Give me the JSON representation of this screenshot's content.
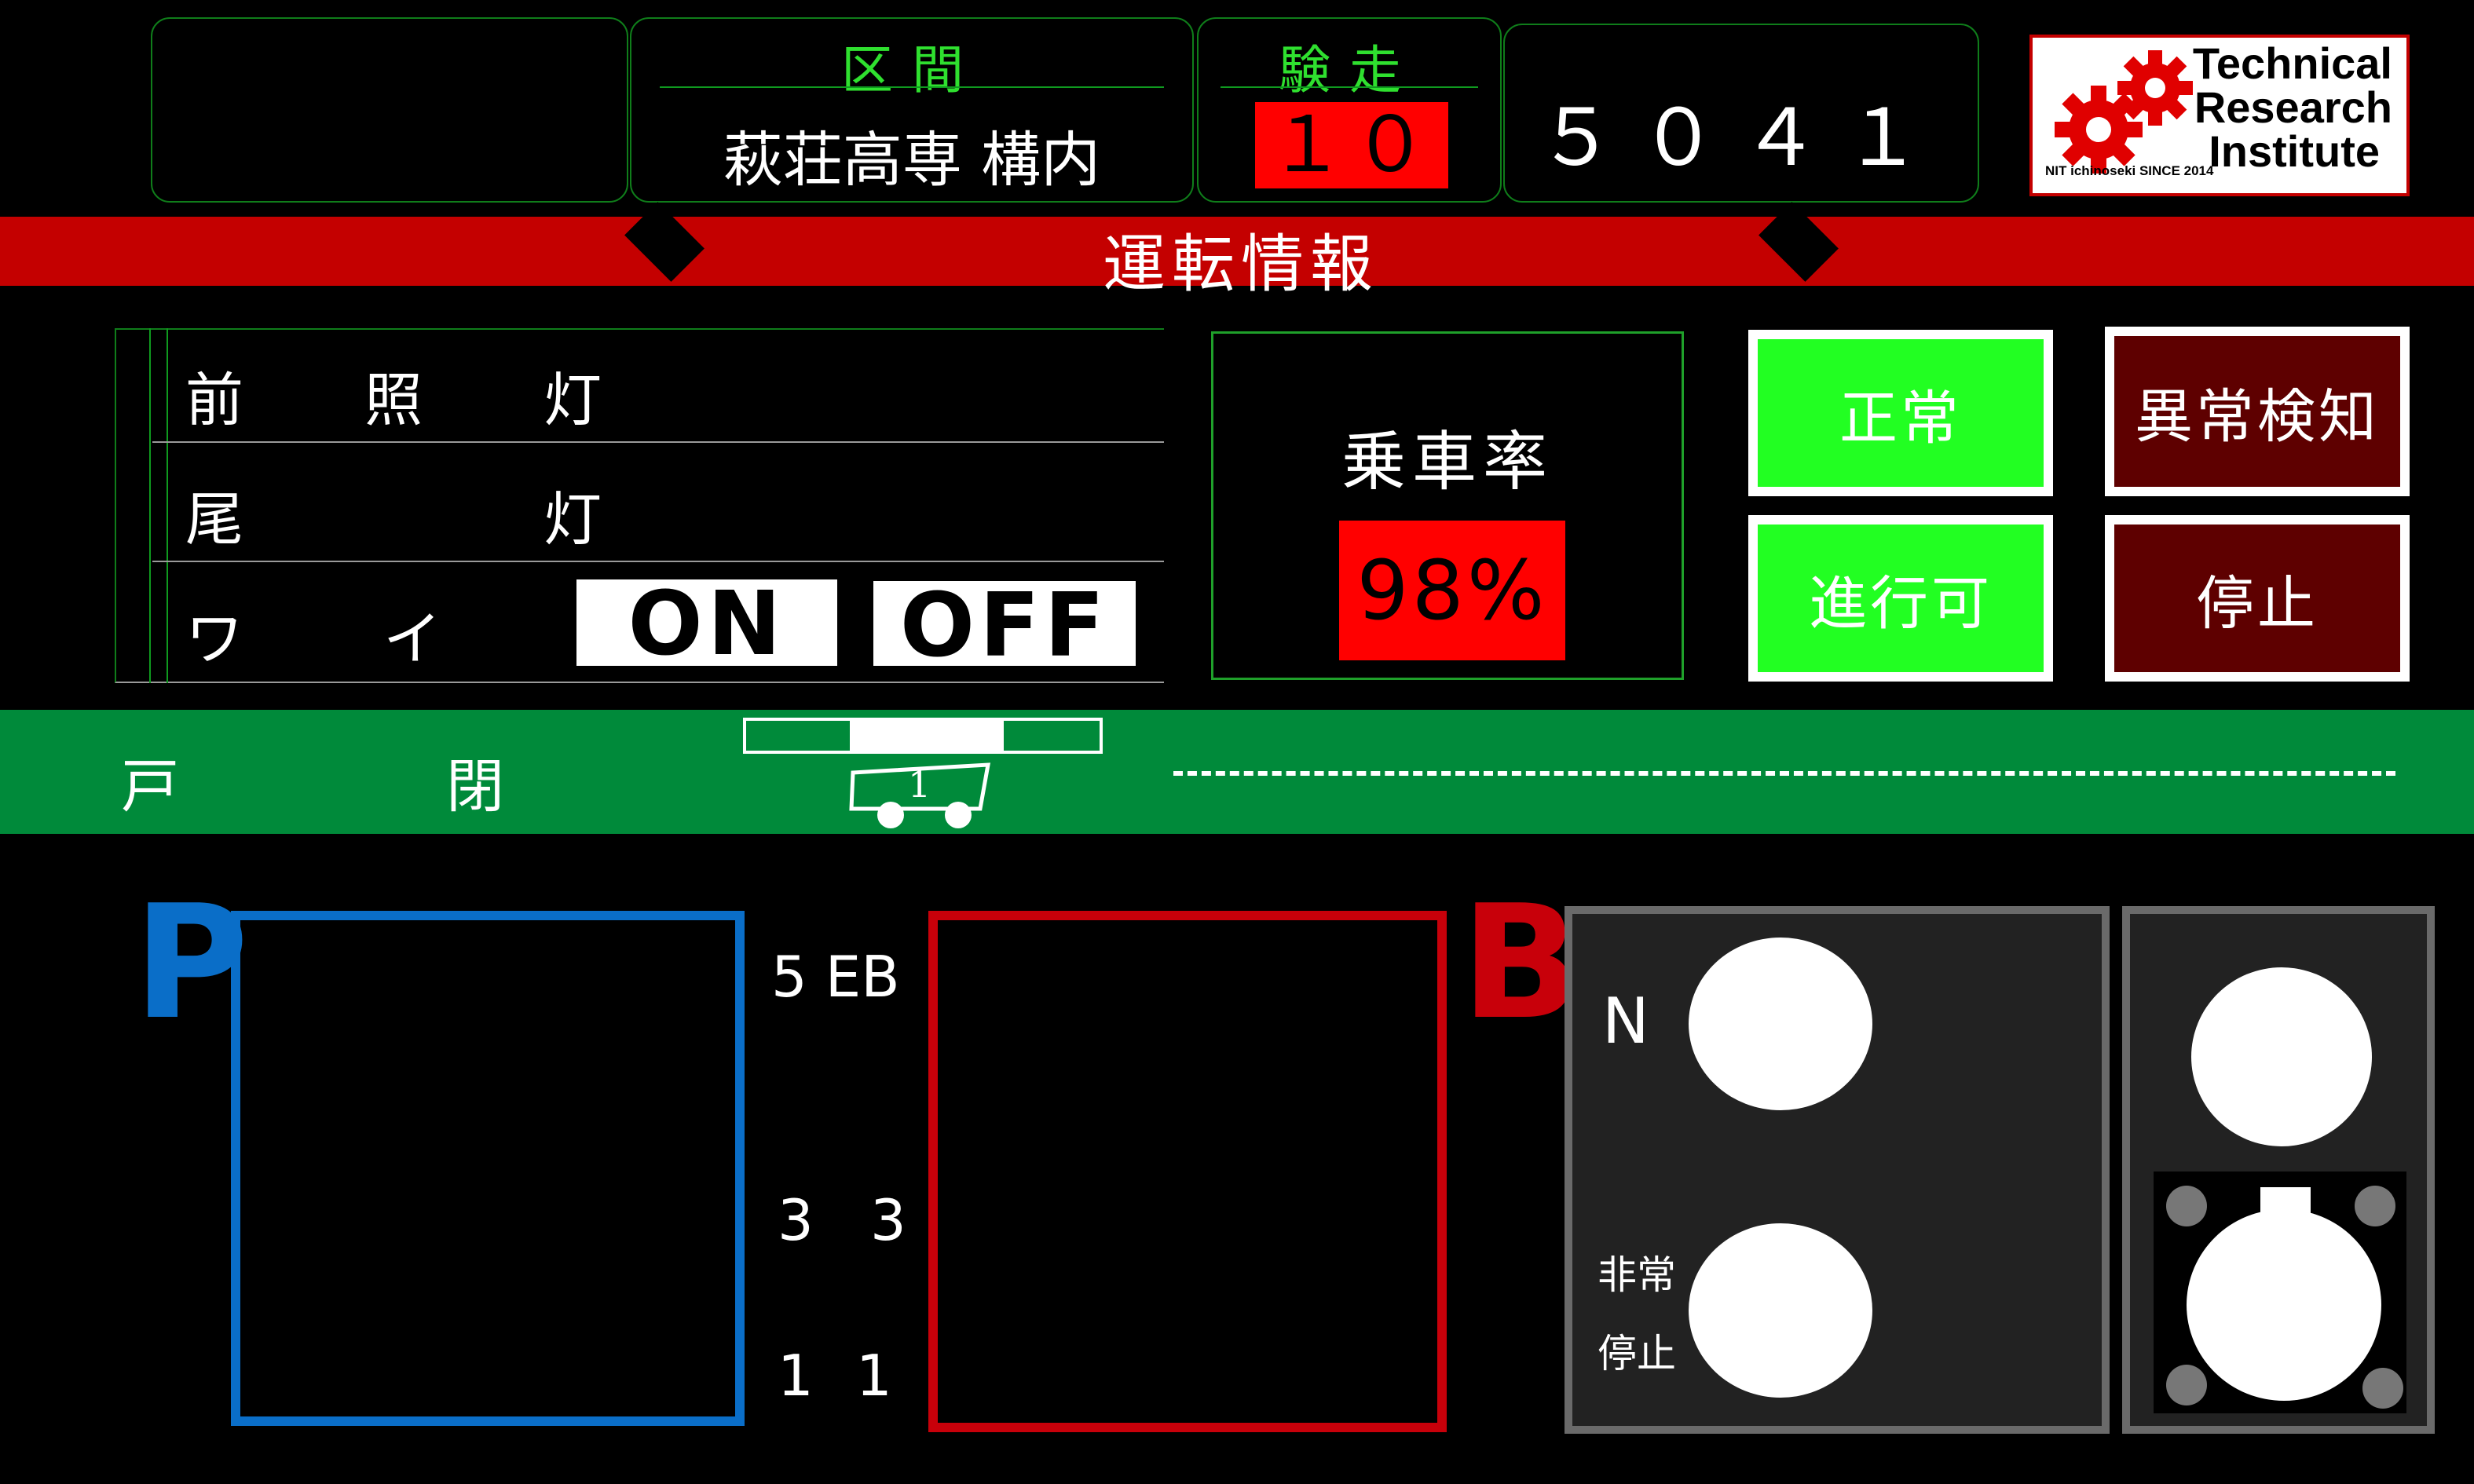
{
  "header": {
    "section_label": "区間",
    "section_value": "萩荘高専 構内",
    "run_label": "験走",
    "run_value": "１０",
    "train_number": "５０４１レ",
    "logo": {
      "text_line1": "Technical",
      "text_line2": "Research",
      "text_line3": "Institute",
      "subtext": "NIT ichinoseki SINCE 2014"
    }
  },
  "banner": {
    "title": "運転情報"
  },
  "info_table": {
    "rows": [
      {
        "label": "前　照　灯"
      },
      {
        "label": "尾　　　灯"
      },
      {
        "label": "ワ　イ　パ　ー"
      }
    ],
    "wiper_on": "ON",
    "wiper_off": "OFF"
  },
  "occupancy": {
    "label": "乗車率",
    "value": "98%"
  },
  "status": {
    "normal": "正常",
    "proceed": "進行可",
    "anomaly": "異常検知",
    "stop": "停止"
  },
  "door": {
    "label_left": "戸",
    "label_right": "閉",
    "car_number": "1"
  },
  "controls": {
    "power_letter": "P",
    "brake_letter": "B",
    "notches": {
      "top": "5 EB",
      "mid_left": "3",
      "mid_right": "3",
      "low_left": "1",
      "low_right": "1"
    },
    "neutral_label": "N",
    "emergency_label_1": "非常",
    "emergency_label_2": "停止"
  },
  "colors": {
    "header_green": "#2fe02f",
    "banner_red": "#c40000",
    "occupancy_red": "#ff0000",
    "status_green": "#22ff22",
    "status_dark_red": "#5e0000",
    "door_green": "#008a3a",
    "power_blue": "#0a6ec8",
    "brake_red": "#c8000a"
  }
}
